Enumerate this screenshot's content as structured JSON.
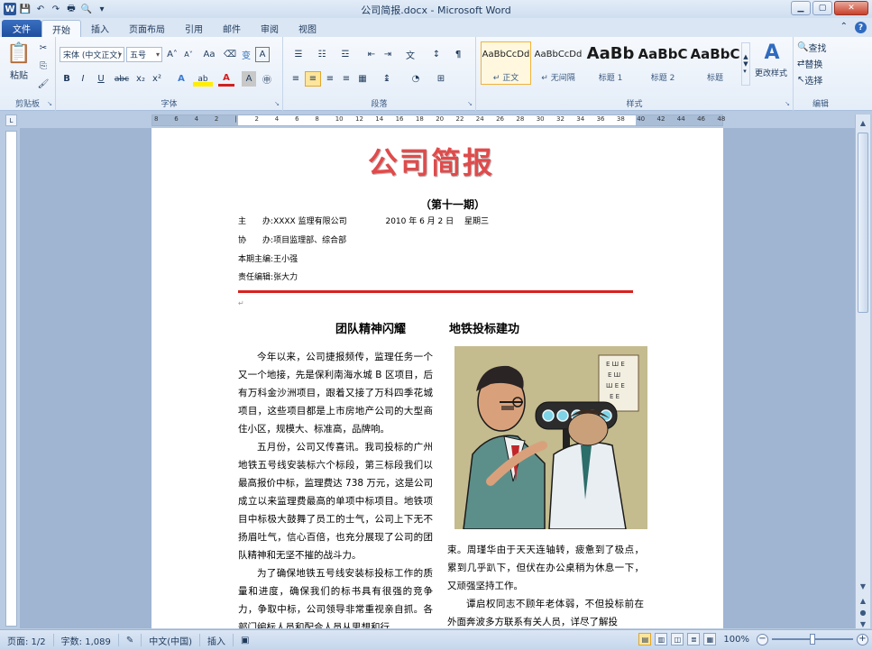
{
  "window": {
    "title": "公司简报.docx - Microsoft Word",
    "controls": {
      "minimize": "▁",
      "maximize": "▢",
      "close": "✕"
    }
  },
  "qat": {
    "save": "💾",
    "undo": "↶",
    "redo": "↷",
    "print": "🖶",
    "preview": "🔍",
    "customize": "▾"
  },
  "tabs": [
    "文件",
    "开始",
    "插入",
    "页面布局",
    "引用",
    "邮件",
    "审阅",
    "视图"
  ],
  "active_tab": "开始",
  "ribbon": {
    "clipboard": {
      "label": "剪贴板",
      "paste": "粘贴",
      "cut": "✂",
      "copy": "⎘",
      "format_painter": "🖌"
    },
    "font": {
      "label": "字体",
      "font_name": "宋体 (中文正文)",
      "font_size": "五号",
      "grow": "A˄",
      "shrink": "A˅",
      "case": "Aa",
      "clear": "⌫",
      "phonetic": "变",
      "border_char": "A",
      "bold": "B",
      "italic": "I",
      "underline": "U",
      "strike": "abc",
      "subscript": "x₂",
      "superscript": "x²",
      "effects": "A",
      "highlight": "ab",
      "font_color": "A",
      "char_shading": "A",
      "enclose": "㊥"
    },
    "paragraph": {
      "label": "段落",
      "bullets": "☰",
      "numbering": "☷",
      "multilevel": "☲",
      "decrease_indent": "⇤",
      "increase_indent": "⇥",
      "chinese_layout": "文",
      "sort": "↕",
      "show_marks": "¶",
      "align_left": "≡",
      "align_center": "≡",
      "align_right": "≡",
      "justify": "≡",
      "distributed": "▦",
      "line_spacing": "↨",
      "shading": "◔",
      "borders": "⊞"
    },
    "styles": {
      "label": "样式",
      "items": [
        {
          "sample": "AaBbCcDd",
          "name": "↵ 正文"
        },
        {
          "sample": "AaBbCcDd",
          "name": "↵ 无间隔"
        },
        {
          "sample": "AaBb",
          "name": "标题 1"
        },
        {
          "sample": "AaBbC",
          "name": "标题 2"
        },
        {
          "sample": "AaBbC",
          "name": "标题"
        }
      ],
      "change_styles": "更改样式"
    },
    "editing": {
      "label": "编辑",
      "find": "查找",
      "replace": "替换",
      "select": "选择"
    }
  },
  "ruler_marks": [
    "8",
    "6",
    "4",
    "2",
    "",
    "2",
    "4",
    "6",
    "8",
    "10",
    "12",
    "14",
    "16",
    "18",
    "20",
    "22",
    "24",
    "26",
    "28",
    "30",
    "32",
    "34",
    "36",
    "38",
    "40",
    "42",
    "44",
    "46",
    "48"
  ],
  "document": {
    "title": "公司简报",
    "issue": "（第十一期）",
    "meta": [
      {
        "key": "主　　办",
        "value": "XXXX 监理有限公司",
        "extra": "2010 年 6 月 2 日　 星期三"
      },
      {
        "key": "协　　办",
        "value": "项目监理部、综合部"
      },
      {
        "key": "本期主编",
        "value": "王小强"
      },
      {
        "key": "责任编辑",
        "value": "张大力"
      }
    ],
    "heading_left": "团队精神闪耀",
    "heading_right": "地铁投标建功",
    "col_left": [
      "今年以来，公司捷报频传，监理任务一个又一个地接，先是保利南海水城 B 区项目，后有万科金沙洲项目，跟着又接了万科四季花城项目，这些项目都是上市房地产公司的大型商住小区，规模大、标准高，品牌响。",
      "五月份，公司又传喜讯。我司投标的广州地铁五号线安装标六个标段，第三标段我们以最高报价中标，监理费达 738 万元，这是公司成立以来监理费最高的单项中标项目。地铁项目中标极大鼓舞了员工的士气，公司上下无不扬眉吐气，信心百倍，也充分展现了公司的团队精神和无坚不摧的战斗力。",
      "为了确保地铁五号线安装标投标工作的质量和进度，确保我们的标书具有很强的竞争力，争取中标，公司领导非常重视亲自抓。各部门编标人员和配合人员从思想和行"
    ],
    "col_right": [
      "束。周瑾华由于天天连轴转，疲惫到了极点，累到几乎趴下，但伏在办公桌稍为休息一下，又顽强坚持工作。",
      "谭启权同志不顾年老体弱，不但投标前在外面奔波多方联系有关人员，详尽了解投"
    ]
  },
  "status": {
    "page": "页面: 1/2",
    "words": "字数: 1,089",
    "language": "中文(中国)",
    "mode": "插入",
    "zoom": "100%",
    "zoom_value": 100
  }
}
